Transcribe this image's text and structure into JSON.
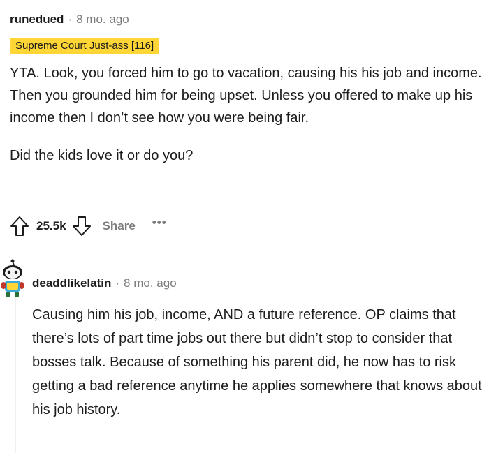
{
  "comment1": {
    "username": "runedued",
    "separator": "·",
    "timestamp": "8 mo. ago",
    "flair": "Supreme Court Just-ass [116]",
    "flair_color": "#ffd635",
    "paragraphs": [
      "YTA. Look, you forced him to go to vacation, causing his his job and income. Then you grounded him for being upset. Unless you offered to make up his income then I don’t see how you were being fair.",
      "Did the kids love it or do you?"
    ],
    "actions": {
      "upvote_icon": "arrow-up-outline-icon",
      "score": "25.5k",
      "downvote_icon": "arrow-down-outline-icon",
      "share_label": "Share",
      "more_label": "•••"
    }
  },
  "comment2": {
    "avatar": "snoo-avatar-icon",
    "username": "deaddlikelatin",
    "separator": "·",
    "timestamp": "8 mo. ago",
    "paragraphs": [
      "Causing him his job, income, AND a future reference. OP claims that there’s lots of part time jobs out there but didn’t stop to consider that bosses talk. Because of something his parent did, he now has to risk getting a bad reference anytime he applies somewhere that knows about his job history."
    ]
  }
}
